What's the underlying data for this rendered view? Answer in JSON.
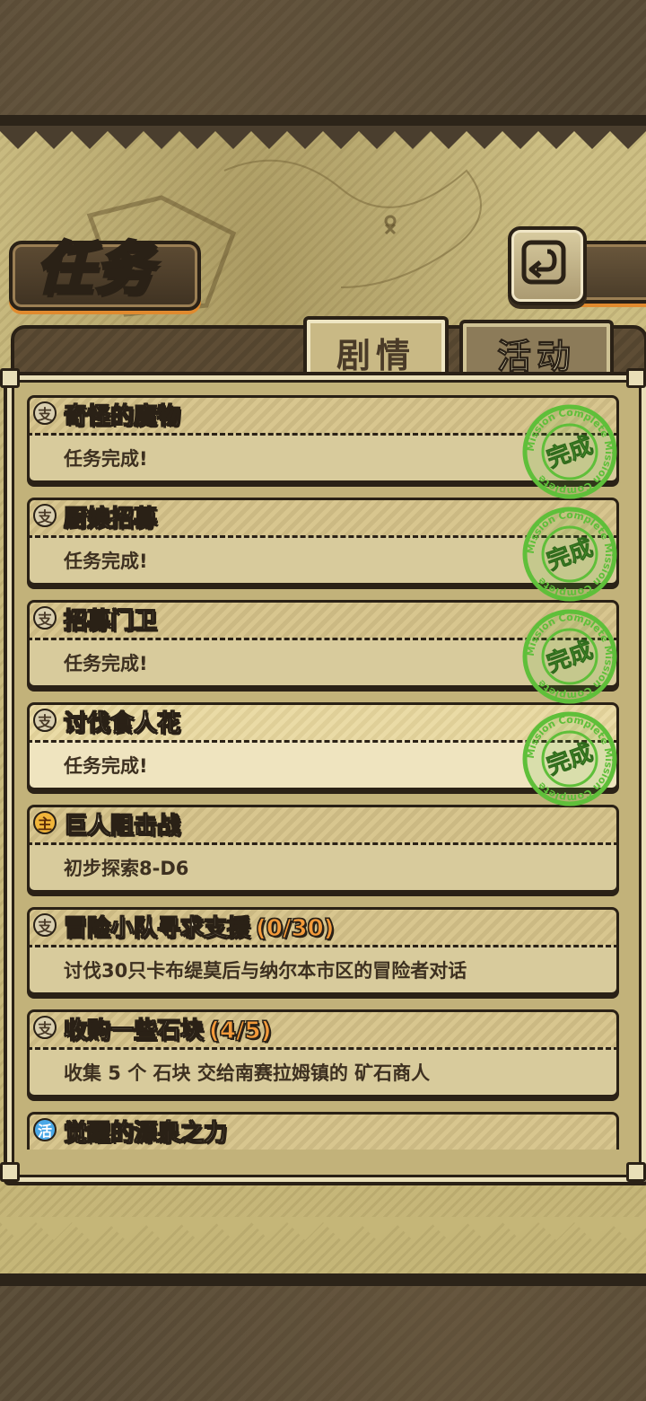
{
  "header": {
    "title": "任务",
    "back_icon": "back-arrow-icon"
  },
  "tabs": [
    {
      "label": "剧情",
      "active": true
    },
    {
      "label": "活动",
      "active": false
    }
  ],
  "quests": [
    {
      "badge": "支",
      "type": "side",
      "title": "奇怪的魔物",
      "progress": "",
      "desc": "任务完成!",
      "completed": true,
      "highlight": false
    },
    {
      "badge": "支",
      "type": "side",
      "title": "厨娘招募",
      "progress": "",
      "desc": "任务完成!",
      "completed": true,
      "highlight": false
    },
    {
      "badge": "支",
      "type": "side",
      "title": "招募门卫",
      "progress": "",
      "desc": "任务完成!",
      "completed": true,
      "highlight": false
    },
    {
      "badge": "支",
      "type": "side",
      "title": "讨伐食人花",
      "progress": "",
      "desc": "任务完成!",
      "completed": true,
      "highlight": true
    },
    {
      "badge": "主",
      "type": "main",
      "title": "巨人阻击战",
      "progress": "",
      "desc": "初步探索8-D6",
      "completed": false,
      "highlight": false
    },
    {
      "badge": "支",
      "type": "side",
      "title": "冒险小队寻求支援",
      "progress": "(0/30)",
      "desc": "讨伐30只卡布缇莫后与纳尔本市区的冒险者对话",
      "completed": false,
      "highlight": false
    },
    {
      "badge": "支",
      "type": "side",
      "title": "收购一些石块",
      "progress": "(4/5)",
      "desc": "收集 5 个 石块 交给南赛拉姆镇的 矿石商人",
      "completed": false,
      "highlight": false
    },
    {
      "badge": "活",
      "type": "event",
      "title": "觉醒的源泉之力",
      "progress": "",
      "desc": "",
      "completed": false,
      "highlight": false
    }
  ],
  "stamp": {
    "center_text": "完成",
    "ring_text": "Mission Complete Mission Complete"
  },
  "colors": {
    "stamp_green": "#5fbf3a",
    "progress_orange": "#f39a3a",
    "frame_dark": "#2a2116",
    "parchment": "#c5b678",
    "accent_orange": "#e08a2e"
  }
}
